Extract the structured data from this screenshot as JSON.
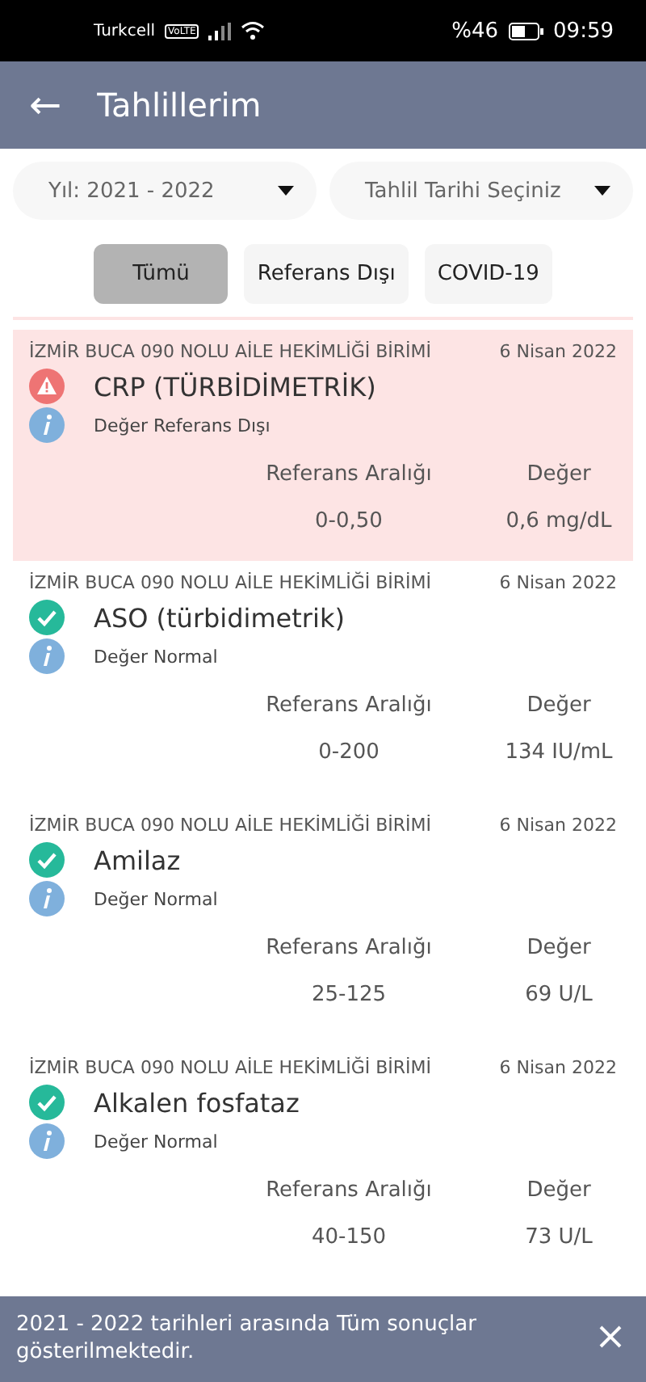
{
  "status_bar": {
    "carrier": "Turkcell",
    "volte": "VoLTE",
    "battery": "%46",
    "time": "09:59"
  },
  "header": {
    "back": "←",
    "title": "Tahlillerim"
  },
  "filters": [
    {
      "label": "Yıl: 2021 - 2022"
    },
    {
      "label": "Tahlil Tarihi Seçiniz"
    }
  ],
  "tabs": [
    {
      "label": "Tümü",
      "selected": true
    },
    {
      "label": "Referans Dışı",
      "selected": false
    },
    {
      "label": "COVID-19",
      "selected": false
    }
  ],
  "results": [
    {
      "kind": "warning",
      "clinic": "İZMİR BUCA 090 NOLU AİLE HEKİMLİĞİ BİRİMİ",
      "date": "6 Nisan 2022",
      "test": "CRP (TÜRBİDİMETRİK)",
      "note": "Değer Referans Dışı",
      "range_label": "Referans Aralığı",
      "value_label": "Değer",
      "range": "0-0,50",
      "value": "0,6 mg/dL"
    },
    {
      "kind": "normal",
      "clinic": "İZMİR BUCA 090 NOLU AİLE HEKİMLİĞİ BİRİMİ",
      "date": "6 Nisan 2022",
      "test": "ASO (türbidimetrik)",
      "note": "Değer Normal",
      "range_label": "Referans Aralığı",
      "value_label": "Değer",
      "range": "0-200",
      "value": "134 IU/mL"
    },
    {
      "kind": "normal",
      "clinic": "İZMİR BUCA 090 NOLU AİLE HEKİMLİĞİ BİRİMİ",
      "date": "6 Nisan 2022",
      "test": "Amilaz",
      "note": "Değer Normal",
      "range_label": "Referans Aralığı",
      "value_label": "Değer",
      "range": "25-125",
      "value": "69 U/L"
    },
    {
      "kind": "normal",
      "clinic": "İZMİR BUCA 090 NOLU AİLE HEKİMLİĞİ BİRİMİ",
      "date": "6 Nisan 2022",
      "test": "Alkalen fosfataz",
      "note": "Değer Normal",
      "range_label": "Referans Aralığı",
      "value_label": "Değer",
      "range": "40-150",
      "value": "73 U/L"
    }
  ],
  "snackbar": {
    "message": "2021 - 2022 tarihleri arasında Tüm sonuçlar gösterilmektedir."
  }
}
